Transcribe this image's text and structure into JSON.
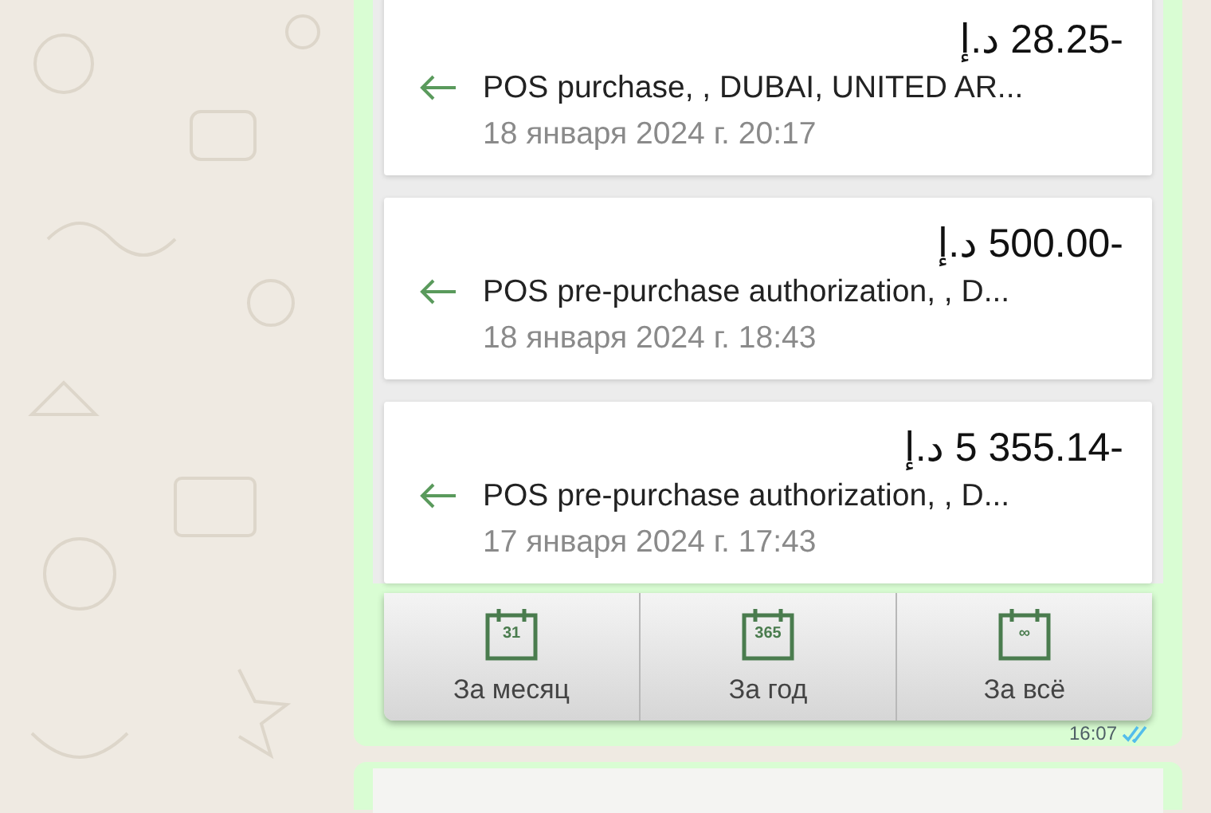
{
  "transactions": [
    {
      "amount": "إ.د 28.25-",
      "description": "POS purchase, , DUBAI, UNITED AR...",
      "date": "18 января 2024 г. 20:17"
    },
    {
      "amount": "إ.د 500.00-",
      "description": "POS pre-purchase authorization, , D...",
      "date": "18 января 2024 г. 18:43"
    },
    {
      "amount": "إ.د 5 355.14-",
      "description": "POS pre-purchase authorization, , D...",
      "date": "17 января 2024 г. 17:43"
    }
  ],
  "periods": [
    {
      "icon_text": "31",
      "label": "За месяц"
    },
    {
      "icon_text": "365",
      "label": "За год"
    },
    {
      "icon_text": "∞",
      "label": "За всё"
    }
  ],
  "message": {
    "time": "16:07",
    "read": true
  }
}
